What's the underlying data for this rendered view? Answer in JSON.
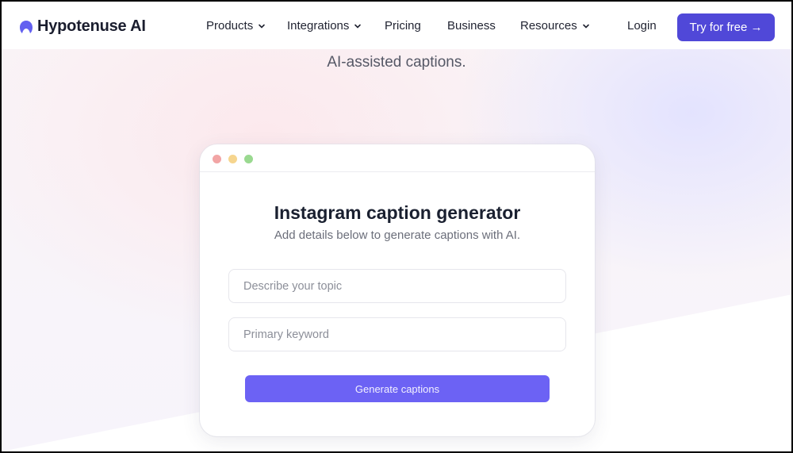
{
  "brand": {
    "name": "Hypotenuse AI",
    "logo_icon": "hypotenuse-logo-icon",
    "accent_color": "#5048d8"
  },
  "nav": {
    "items": [
      {
        "label": "Products",
        "has_dropdown": true
      },
      {
        "label": "Integrations",
        "has_dropdown": true
      },
      {
        "label": "Pricing",
        "has_dropdown": false
      },
      {
        "label": "Business",
        "has_dropdown": false
      },
      {
        "label": "Resources",
        "has_dropdown": true
      }
    ],
    "login_label": "Login",
    "cta_label": "Try for free →"
  },
  "hero": {
    "subtitle": "AI-assisted captions."
  },
  "tool_card": {
    "window_dots": [
      "red",
      "yellow",
      "green"
    ],
    "title": "Instagram caption generator",
    "description": "Add details below to generate captions with AI.",
    "fields": [
      {
        "placeholder": "Describe your topic",
        "value": ""
      },
      {
        "placeholder": "Primary keyword",
        "value": ""
      }
    ],
    "submit_label": "Generate captions",
    "button_color": "#6c62f4"
  }
}
